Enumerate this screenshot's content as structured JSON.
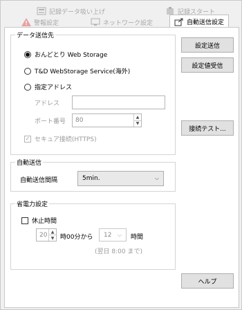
{
  "tabs": {
    "top_left": "記録データ吸い上げ",
    "top_right": "記録スタート",
    "warning": "警報設定",
    "network": "ネットワーク設定",
    "active": "自動送信設定"
  },
  "data_dest": {
    "legend": "データ送信先",
    "options": [
      "おんどとり Web Storage",
      "T&D WebStorage Service(海外)",
      "指定アドレス"
    ],
    "selected_index": 0,
    "address_label": "アドレス",
    "address_value": "",
    "port_label": "ポート番号",
    "port_value": "80",
    "secure_label": "セキュア接続(HTTPS)",
    "secure_checked": true
  },
  "auto_send": {
    "legend": "自動送信",
    "interval_label": "自動送信間隔",
    "interval_value": "5min."
  },
  "power_save": {
    "legend": "省電力設定",
    "pause_label": "休止時間",
    "pause_checked": false,
    "start_hour": "20",
    "from_label": "時00分から",
    "hours_value": "12",
    "hours_label": "時間",
    "note": "(翌日 8:00 まで)"
  },
  "buttons": {
    "send_settings": "設定送信",
    "receive_settings": "設定値受信",
    "connection_test": "接続テスト...",
    "help": "ヘルプ"
  },
  "colors": {
    "window_bg": "#f0f0f0",
    "panel_bg": "#ffffff",
    "disabled_text": "#9a9a9a",
    "warning_icon": "#d04040",
    "active_icon": "#333333"
  }
}
